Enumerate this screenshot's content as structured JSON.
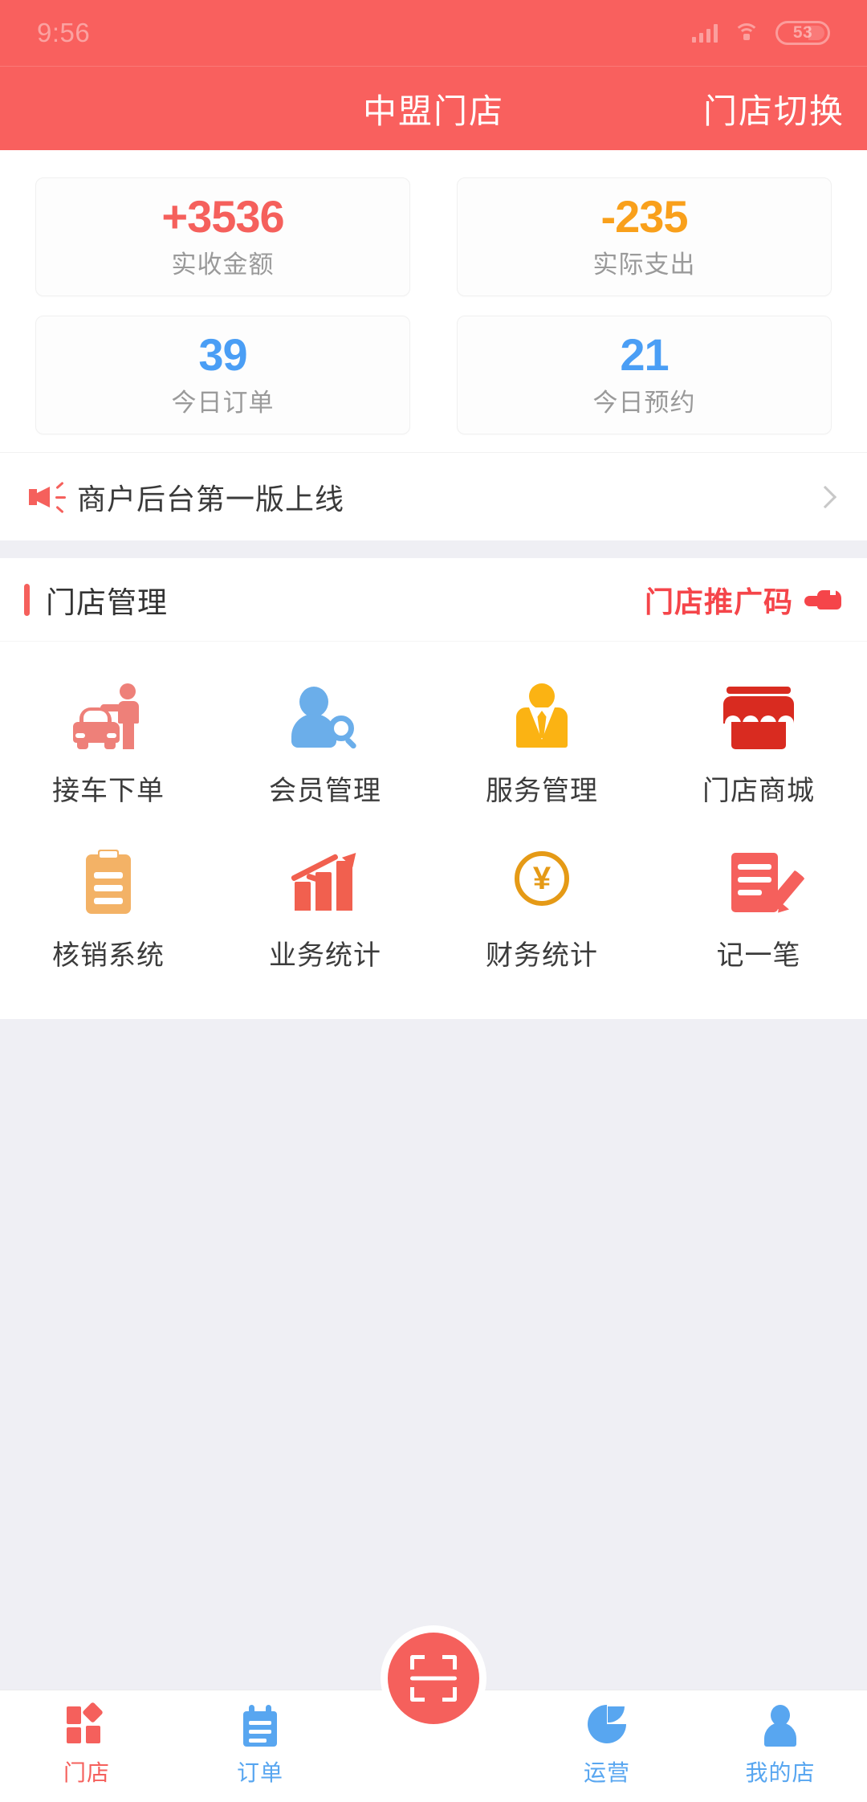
{
  "status_bar": {
    "time": "9:56",
    "battery_level": "53",
    "signal_icon": "signal-bars-icon",
    "wifi_icon": "wifi-icon"
  },
  "header": {
    "title": "中盟门店",
    "switch_store_label": "门店切换",
    "background_color": "#F9605E"
  },
  "stats": {
    "cards": [
      {
        "value": "+3536",
        "label": "实收金额",
        "color": "#F5605C"
      },
      {
        "value": "-235",
        "label": "实际支出",
        "color": "#F9A01B"
      },
      {
        "value": "39",
        "label": "今日订单",
        "color": "#4A9EF5"
      },
      {
        "value": "21",
        "label": "今日预约",
        "color": "#4A9EF5"
      }
    ]
  },
  "announcement": {
    "icon": "megaphone-icon",
    "text": "商户后台第一版上线",
    "chevron": "chevron-right-icon"
  },
  "store_management": {
    "section_title": "门店管理",
    "promo_code_label": "门店推广码",
    "promo_code_icon": "hand-pointer-icon",
    "accent_color": "#F5605C",
    "items": [
      {
        "label": "接车下单",
        "icon": "car-order-icon",
        "color": "#EE8079"
      },
      {
        "label": "会员管理",
        "icon": "member-search-icon",
        "color": "#6BAEEA"
      },
      {
        "label": "服务管理",
        "icon": "service-staff-icon",
        "color": "#FBB313"
      },
      {
        "label": "门店商城",
        "icon": "storefront-icon",
        "color": "#D92B20"
      },
      {
        "label": "核销系统",
        "icon": "clipboard-icon",
        "color": "#F3B266"
      },
      {
        "label": "业务统计",
        "icon": "growth-chart-icon",
        "color": "#F1604F"
      },
      {
        "label": "财务统计",
        "icon": "yen-coin-icon",
        "color": "#E59A16"
      },
      {
        "label": "记一笔",
        "icon": "note-pencil-icon",
        "color": "#F5605C"
      }
    ]
  },
  "tab_bar": {
    "tabs": [
      {
        "label": "门店",
        "icon": "store-icon",
        "active": true
      },
      {
        "label": "订单",
        "icon": "order-icon",
        "active": false
      },
      {
        "label": "运营",
        "icon": "pie-chart-icon",
        "active": false
      },
      {
        "label": "我的店",
        "icon": "user-icon",
        "active": false
      }
    ],
    "scan_button": {
      "icon": "scan-qr-icon",
      "color": "#F5605C"
    },
    "active_color": "#F5605C",
    "inactive_color": "#58A6F0"
  }
}
